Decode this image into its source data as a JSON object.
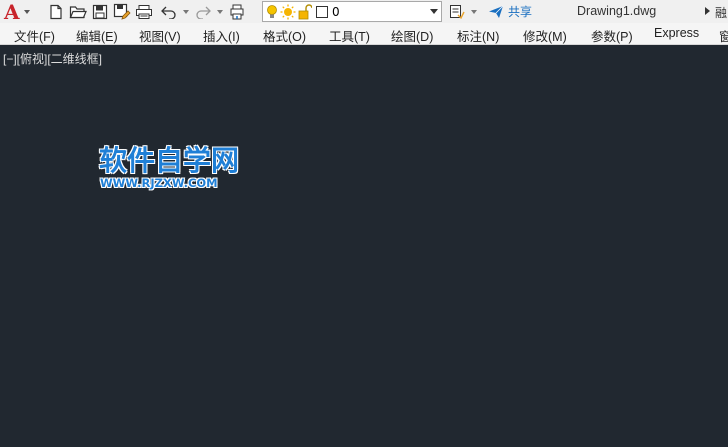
{
  "quick_access": {
    "app_letter": "A",
    "icons": [
      "new-icon",
      "open-icon",
      "save-icon",
      "save-as-icon",
      "plot-icon",
      "undo-icon",
      "redo-icon",
      "publish-icon"
    ]
  },
  "layer": {
    "current": "0",
    "icons": [
      "lightbulb-icon",
      "sun-icon",
      "lock-icon",
      "color-swatch-icon"
    ]
  },
  "share_label": "共享",
  "document_title": "Drawing1.dwg",
  "edge_text": "融",
  "menu": [
    "文件(F)",
    "编辑(E)",
    "视图(V)",
    "插入(I)",
    "格式(O)",
    "工具(T)",
    "绘图(D)",
    "标注(N)",
    "修改(M)",
    "参数(P)",
    "Express",
    "窗"
  ],
  "viewport": {
    "label": "[−][俯视][二维线框]"
  },
  "watermark": {
    "title": "软件自学网",
    "url": "WWW.RJZXW.COM"
  },
  "colors": {
    "canvas": "#212830",
    "toolbar": "#f0f0f0",
    "accent": "#1f7fd6",
    "app_red": "#c8242b"
  }
}
